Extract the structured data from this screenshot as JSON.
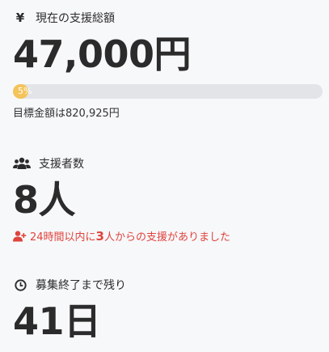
{
  "funding": {
    "icon": "yen-icon",
    "label": "現在の支援総額",
    "amount": "47,000円",
    "progress_percent": 5,
    "progress_text": "5%",
    "goal_text": "目標金額は820,925円"
  },
  "supporters": {
    "icon": "users-icon",
    "label": "支援者数",
    "count": "8人",
    "recent_prefix": "24時間以内に",
    "recent_count": "3",
    "recent_suffix": "人からの支援がありました",
    "recent_icon": "user-plus-icon"
  },
  "remaining": {
    "icon": "clock-icon",
    "label": "募集終了まで残り",
    "days": "41日"
  },
  "colors": {
    "progress_fill": "#f4c35a",
    "progress_track": "#e3e4e7",
    "alert": "#e0433d"
  }
}
